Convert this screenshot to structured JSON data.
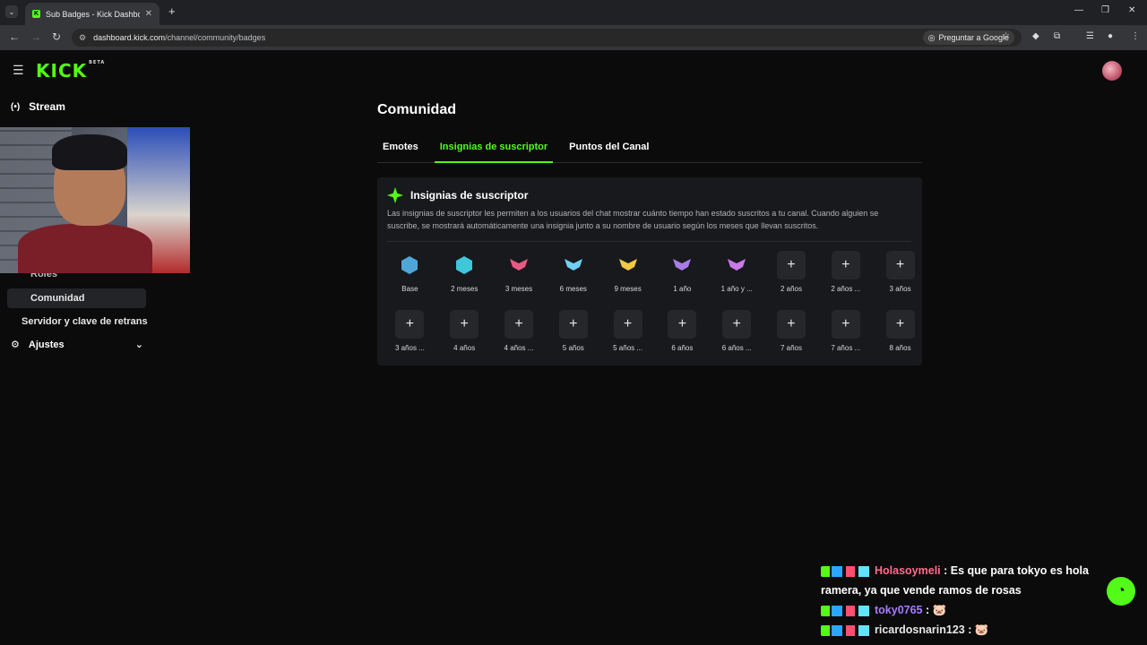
{
  "browser": {
    "tab_title": "Sub Badges - Kick Dashboard",
    "url_host": "dashboard.kick.com",
    "url_path": "/channel/community/badges",
    "ask_google": "Preguntar a Google"
  },
  "app": {
    "logo": "KICK",
    "logo_badge": "BETA"
  },
  "sidebar": {
    "stream": "Stream",
    "roles": "Roles",
    "community": "Comunidad",
    "server": "Servidor y clave de retrans",
    "settings": "Ajustes"
  },
  "main": {
    "title": "Comunidad",
    "tabs": [
      "Emotes",
      "Insignias de suscriptor",
      "Puntos del Canal"
    ],
    "panel_title": "Insignias de suscriptor",
    "panel_desc": "Las insignias de suscriptor les permiten a los usuarios del chat mostrar cuánto tiempo han estado suscritos a tu canal. Cuando alguien se suscribe, se mostrará automáticamente una insignia junto a su nombre de usuario según los meses que llevan suscritos.",
    "badges": [
      {
        "label": "Base",
        "icon": "gem-badge-icon",
        "color": "#4fa6d8"
      },
      {
        "label": "2 meses",
        "icon": "hex-gem-badge-icon",
        "color": "#3ec7d9"
      },
      {
        "label": "3 meses",
        "icon": "wing-badge-icon",
        "color": "#e85a83"
      },
      {
        "label": "6 meses",
        "icon": "wing-badge-icon",
        "color": "#6ed0f2"
      },
      {
        "label": "9 meses",
        "icon": "crown-wing-badge-icon",
        "color": "#f2c744"
      },
      {
        "label": "1 año",
        "icon": "wing-badge-icon",
        "color": "#a97ae8"
      },
      {
        "label": "1 año y ...",
        "icon": "orb-wing-badge-icon",
        "color": "#c97ae8"
      },
      {
        "label": "2 años",
        "icon": "plus-icon"
      },
      {
        "label": "2 años ...",
        "icon": "plus-icon"
      },
      {
        "label": "3 años",
        "icon": "plus-icon"
      },
      {
        "label": "3 años ...",
        "icon": "plus-icon"
      },
      {
        "label": "4 años",
        "icon": "plus-icon"
      },
      {
        "label": "4 años ...",
        "icon": "plus-icon"
      },
      {
        "label": "5 años",
        "icon": "plus-icon"
      },
      {
        "label": "5 años ...",
        "icon": "plus-icon"
      },
      {
        "label": "6 años",
        "icon": "plus-icon"
      },
      {
        "label": "6 años ...",
        "icon": "plus-icon"
      },
      {
        "label": "7 años",
        "icon": "plus-icon"
      },
      {
        "label": "7 años ...",
        "icon": "plus-icon"
      },
      {
        "label": "8 años",
        "icon": "plus-icon"
      }
    ]
  },
  "chat": [
    {
      "user": "Holasoymeli",
      "color": "#ff6b8b",
      "text": "Es que para tokyo es hola ramera, ya que vende ramos de rosas"
    },
    {
      "user": "toky0765",
      "color": "#a77bff",
      "text": "🐷"
    },
    {
      "user": "ricardosnarin123",
      "color": "#e8e8e8",
      "text": "🐷"
    }
  ],
  "colors": {
    "accent": "#53fc18",
    "bg": "#0b0b0c",
    "panel": "#18191c"
  }
}
